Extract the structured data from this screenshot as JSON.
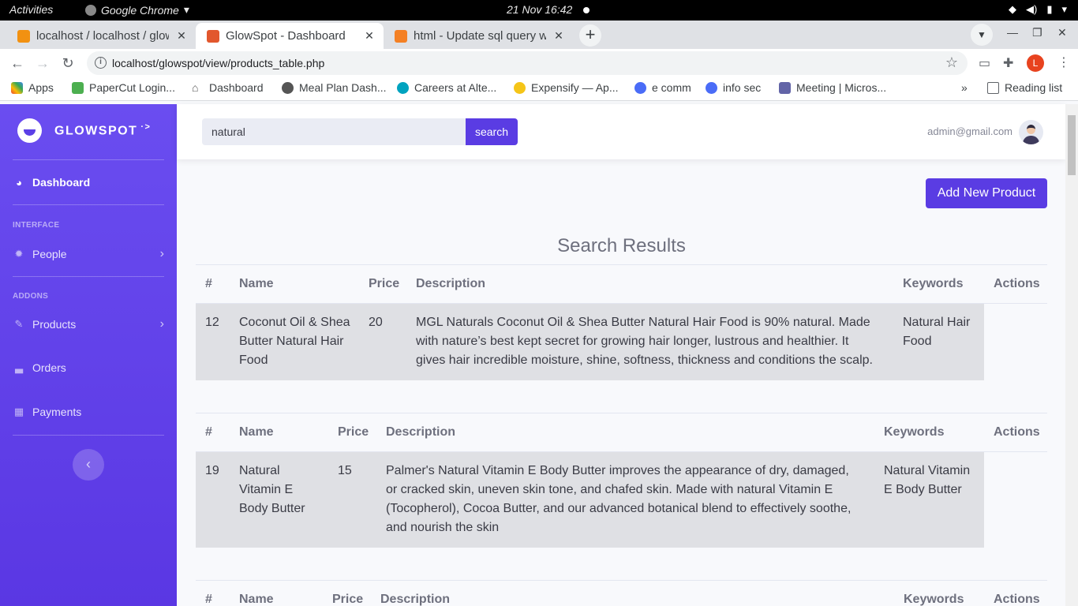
{
  "os": {
    "activities": "Activities",
    "app_name": "Google Chrome",
    "clock": "21 Nov  16:42"
  },
  "browser": {
    "tabs": [
      {
        "title": "localhost / localhost / glowspot",
        "color": "#f29111"
      },
      {
        "title": "GlowSpot - Dashboard",
        "color": "#e2572d"
      },
      {
        "title": "html - Update sql query when",
        "color": "#f48024"
      }
    ],
    "new_tab_symbol": "+",
    "url": "localhost/glowspot/view/products_table.php",
    "profile_initial": "L",
    "bookmarks": [
      {
        "label": "Apps",
        "color": "#ea4335"
      },
      {
        "label": "PaperCut Login...",
        "color": "#4caf50"
      },
      {
        "label": "Dashboard",
        "color": "#555555"
      },
      {
        "label": "Meal Plan Dash...",
        "color": "#555555"
      },
      {
        "label": "Careers at Alte...",
        "color": "#00a3bf"
      },
      {
        "label": "Expensify — Ap...",
        "color": "#f5c518"
      },
      {
        "label": "e comm",
        "color": "#4a6cf7"
      },
      {
        "label": "info sec",
        "color": "#4a6cf7"
      },
      {
        "label": "Meeting | Micros...",
        "color": "#6264a7"
      }
    ],
    "overflow": "»",
    "reading_list": "Reading list"
  },
  "sidebar": {
    "brand": "GLOWSPOT",
    "brand_suffix": "·>",
    "dashboard": "Dashboard",
    "interface_heading": "INTERFACE",
    "people": "People",
    "addons_heading": "ADDONS",
    "products": "Products",
    "orders": "Orders",
    "payments": "Payments",
    "toggle_symbol": "‹"
  },
  "topnav": {
    "search_value": "natural",
    "search_button": "search",
    "user_email": "admin@gmail.com"
  },
  "main": {
    "add_button": "Add New Product",
    "results_title": "Search Results",
    "headers": {
      "id": "#",
      "name": "Name",
      "price": "Price",
      "description": "Description",
      "keywords": "Keywords",
      "actions": "Actions"
    },
    "results": [
      {
        "id": "12",
        "name": "Coconut Oil & Shea Butter Natural Hair Food",
        "price": "20",
        "description": "MGL Naturals Coconut Oil & Shea Butter Natural Hair Food is 90% natural. Made with nature’s best kept secret for growing hair longer, lustrous and healthier. It gives hair incredible moisture, shine, softness, thickness and conditions the scalp.",
        "keywords": "Natural Hair Food"
      },
      {
        "id": "19",
        "name": "Natural Vitamin E Body Butter",
        "price": "15",
        "description": "Palmer's Natural Vitamin E Body Butter improves the appearance of dry, damaged, or cracked skin, uneven skin tone, and chafed skin. Made with natural Vitamin E (Tocopherol), Cocoa Butter, and our advanced botanical blend to effectively soothe, and nourish the skin",
        "keywords": "Natural Vitamin E Body Butter"
      }
    ]
  },
  "colors": {
    "sidebar": "#5f42ea",
    "accent": "#5a3ce3",
    "row_bg": "#dfe0e4"
  }
}
